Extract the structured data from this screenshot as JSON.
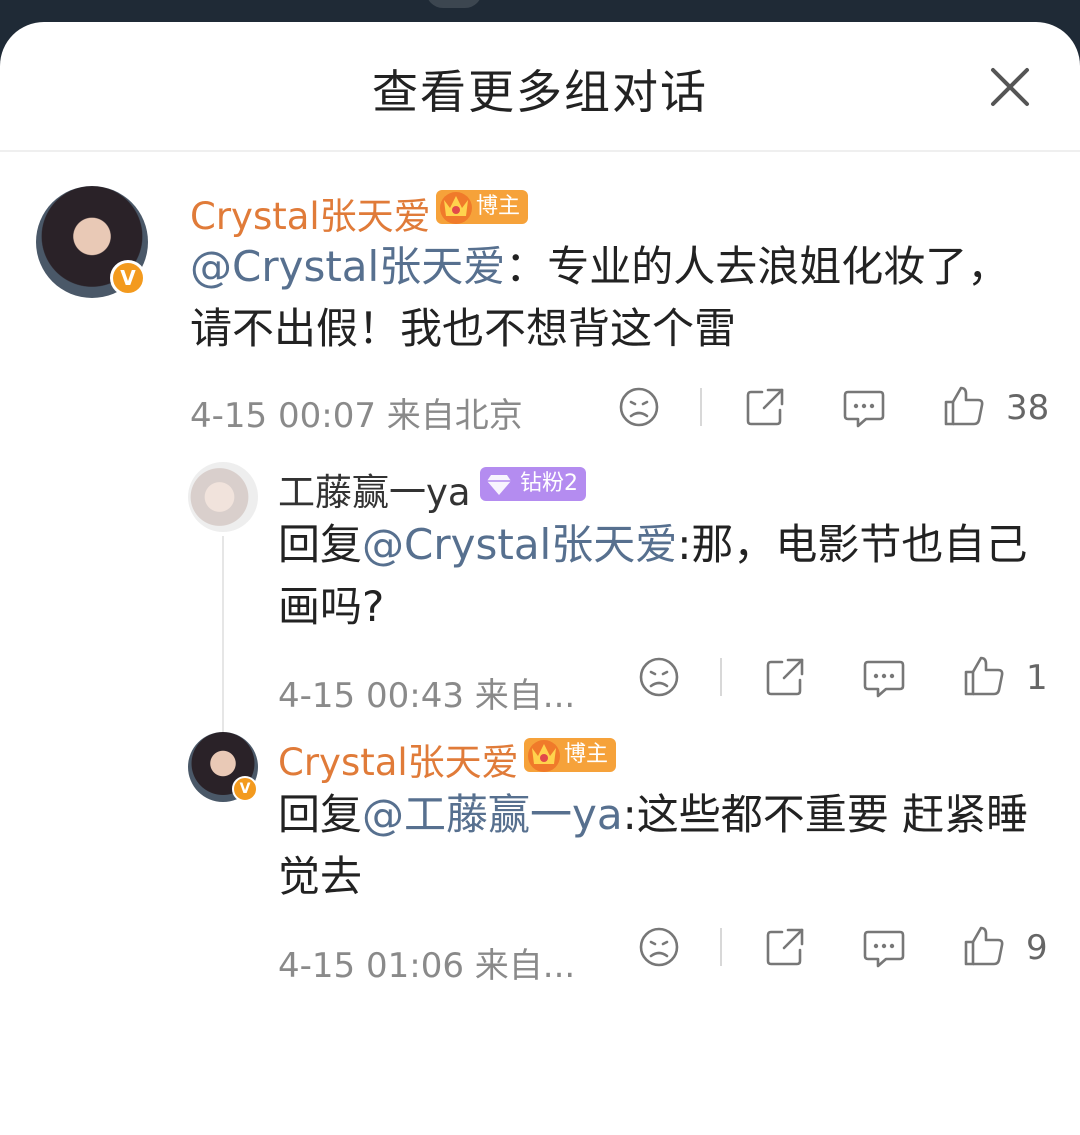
{
  "header": {
    "title": "查看更多组对话"
  },
  "comments": [
    {
      "username": "Crystal张天爱",
      "badge": "博主",
      "mention": "@Crystal张天爱",
      "text": "：专业的人去浪姐化妆了，请不出假！我也不想背这个雷",
      "time": "4-15 00:07",
      "location": "来自北京",
      "likes": "38"
    },
    {
      "username": "工藤赢一ya",
      "badge": "钻粉2",
      "reply_prefix": "回复",
      "mention": "@Crystal张天爱",
      "text": ":那，电影节也自己画吗?",
      "time": "4-15 00:43",
      "location": "来自...",
      "likes": "1"
    },
    {
      "username": "Crystal张天爱",
      "badge": "博主",
      "reply_prefix": "回复",
      "mention": "@工藤赢一ya",
      "text": ":这些都不重要 赶紧睡觉去",
      "time": "4-15 01:06",
      "location": "来自...",
      "likes": "9"
    }
  ],
  "icons": {
    "verified": "verified-v-icon",
    "dislike": "sad-face-icon",
    "share": "share-icon",
    "comment": "comment-bubble-icon",
    "like": "thumbs-up-icon"
  },
  "colors": {
    "username_orange": "#e07b39",
    "mention_blue": "#57708f",
    "verified_badge": "#f39a1e",
    "blogger_badge": "#f6a23a",
    "fan_badge": "#b48cf0"
  }
}
